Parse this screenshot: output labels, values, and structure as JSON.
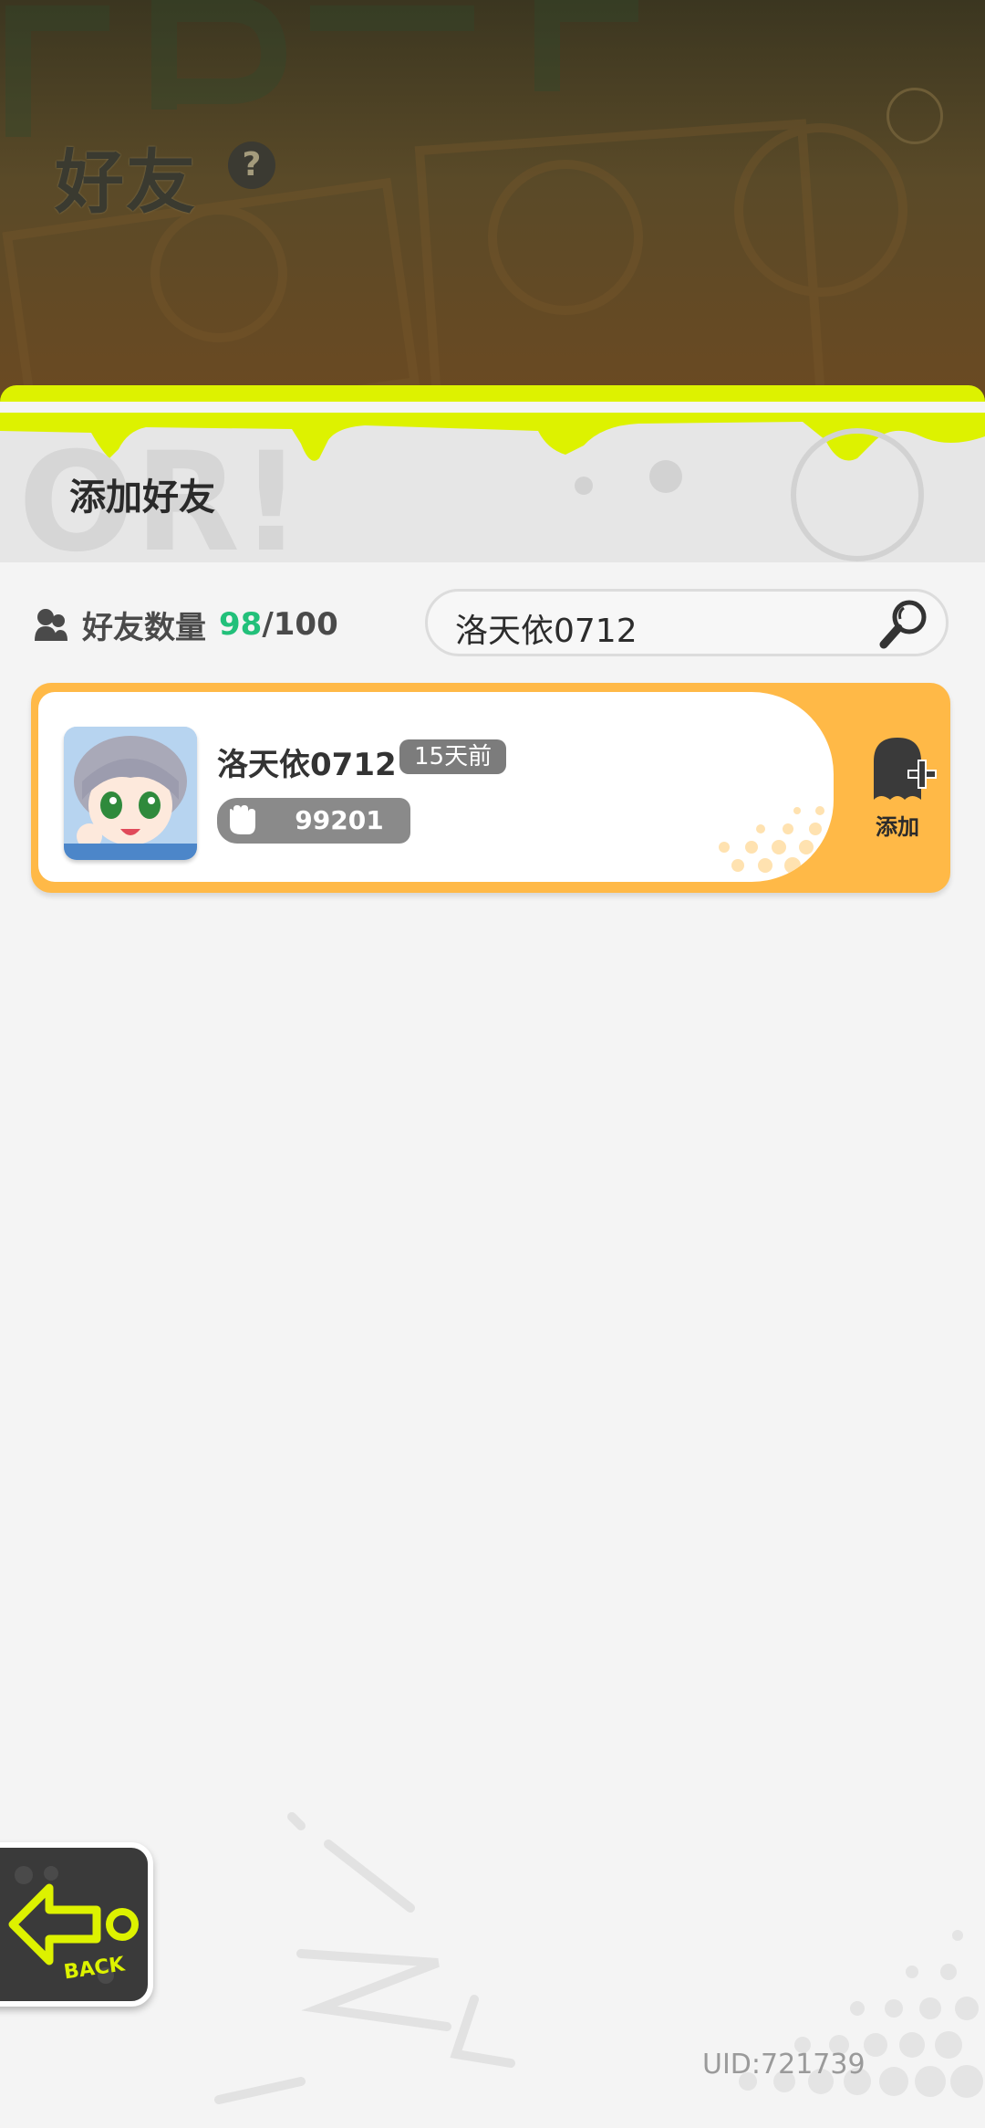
{
  "header": {
    "title": "好友",
    "help_icon": "question-mark-icon",
    "accent_color": "#ddf200"
  },
  "section": {
    "title": "添加好友"
  },
  "friends": {
    "count_label": "好友数量",
    "count_now": "98",
    "count_sep": "/",
    "count_max": "100"
  },
  "search": {
    "value": "洛天依0712",
    "icon": "search-icon"
  },
  "result": {
    "name": "洛天依0712",
    "last_seen": "15天前",
    "score": "99201",
    "add_label": "添加",
    "card_color": "#ffb947"
  },
  "footer": {
    "back_label": "BACK",
    "uid": "UID:721739"
  }
}
